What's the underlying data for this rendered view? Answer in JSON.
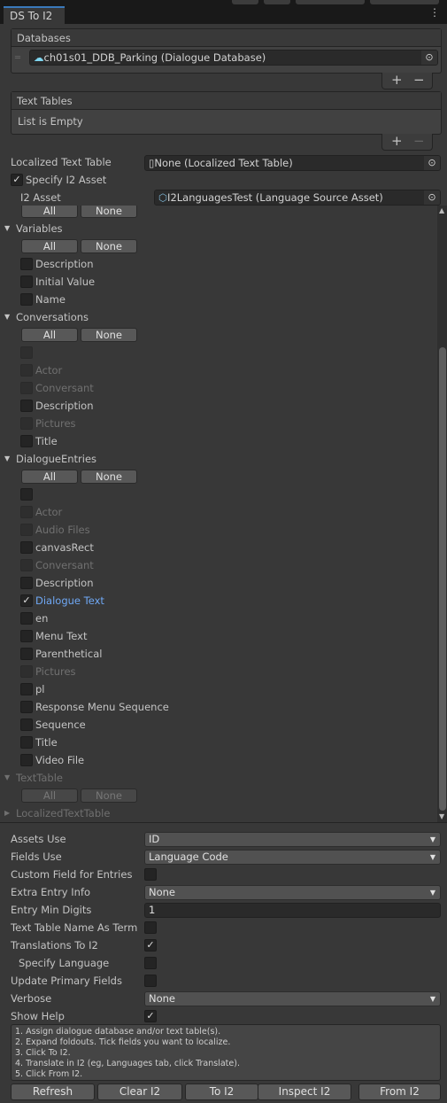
{
  "window": {
    "tab": "DS To I2",
    "menu_icon": "kebab-icon"
  },
  "databases": {
    "header": "Databases",
    "items": [
      {
        "value": "ch01s01_DDB_Parking (Dialogue Database)",
        "icon": "dialogue-database-icon"
      }
    ]
  },
  "text_tables": {
    "header": "Text Tables",
    "empty": "List is Empty"
  },
  "localized_text_table": {
    "label": "Localized Text Table",
    "value": "None (Localized Text Table)"
  },
  "specify_i2": {
    "label": "Specify I2 Asset",
    "checked": true
  },
  "i2_asset": {
    "label": "I2 Asset",
    "value": "I2LanguagesTest (Language Source Asset)"
  },
  "buttons": {
    "all": "All",
    "none": "None",
    "plus": "+",
    "minus": "−"
  },
  "foldouts": [
    {
      "title": "Variables",
      "expanded": true,
      "items": [
        {
          "label": "Description",
          "checked": false
        },
        {
          "label": "Initial Value",
          "checked": false
        },
        {
          "label": "Name",
          "checked": false
        }
      ]
    },
    {
      "title": "Conversations",
      "expanded": true,
      "items": [
        {
          "label": "",
          "checked": false,
          "disabled": true
        },
        {
          "label": "Actor",
          "disabled": true
        },
        {
          "label": "Conversant",
          "disabled": true
        },
        {
          "label": "Description",
          "checked": false
        },
        {
          "label": "Pictures",
          "disabled": true
        },
        {
          "label": "Title",
          "checked": false
        }
      ]
    },
    {
      "title": "DialogueEntries",
      "expanded": true,
      "items": [
        {
          "label": "",
          "checked": false
        },
        {
          "label": "Actor",
          "disabled": true
        },
        {
          "label": "Audio Files",
          "disabled": true
        },
        {
          "label": "canvasRect",
          "checked": false
        },
        {
          "label": "Conversant",
          "disabled": true
        },
        {
          "label": "Description",
          "checked": false
        },
        {
          "label": "Dialogue Text",
          "checked": true,
          "selected": true
        },
        {
          "label": "en",
          "checked": false
        },
        {
          "label": "Menu Text",
          "checked": false
        },
        {
          "label": "Parenthetical",
          "checked": false
        },
        {
          "label": "Pictures",
          "disabled": true
        },
        {
          "label": "pl",
          "checked": false
        },
        {
          "label": "Response Menu Sequence",
          "checked": false
        },
        {
          "label": "Sequence",
          "checked": false
        },
        {
          "label": "Title",
          "checked": false
        },
        {
          "label": "Video File",
          "checked": false
        }
      ]
    },
    {
      "title": "TextTable",
      "expanded": true,
      "disabled": true,
      "items": []
    },
    {
      "title": "LocalizedTextTable",
      "expanded": false,
      "disabled": true,
      "items": []
    }
  ],
  "settings": [
    {
      "label": "Assets Use",
      "type": "dropdown",
      "value": "ID"
    },
    {
      "label": "Fields Use",
      "type": "dropdown",
      "value": "Language Code"
    },
    {
      "label": "Custom Field for Entries",
      "type": "checkbox",
      "checked": false
    },
    {
      "label": "Extra Entry Info",
      "type": "dropdown",
      "value": "None"
    },
    {
      "label": "Entry Min Digits",
      "type": "text",
      "value": "1"
    },
    {
      "label": "Text Table Name As Term",
      "type": "checkbox",
      "checked": false
    },
    {
      "label": "Translations To I2",
      "type": "checkbox",
      "checked": true
    },
    {
      "label": "Specify Language",
      "type": "checkbox",
      "checked": false,
      "indent": true
    },
    {
      "label": "Update Primary Fields",
      "type": "checkbox",
      "checked": false
    },
    {
      "label": "Verbose",
      "type": "dropdown",
      "value": "None"
    },
    {
      "label": "Show Help",
      "type": "checkbox",
      "checked": true
    }
  ],
  "help": [
    "1. Assign dialogue database and/or text table(s).",
    "2. Expand foldouts. Tick fields you want to localize.",
    "3. Click To I2.",
    "4. Translate in I2 (eg, Languages tab, click Translate).",
    "5. Click From I2."
  ],
  "actions": [
    "Refresh",
    "Clear I2",
    "To I2",
    "Inspect I2",
    "From I2"
  ],
  "colors": {
    "background": "#383838",
    "field": "#2a2a2a",
    "button": "#585858",
    "selected_text": "#6fa8f5",
    "tab_accent": "#3a79bb"
  }
}
